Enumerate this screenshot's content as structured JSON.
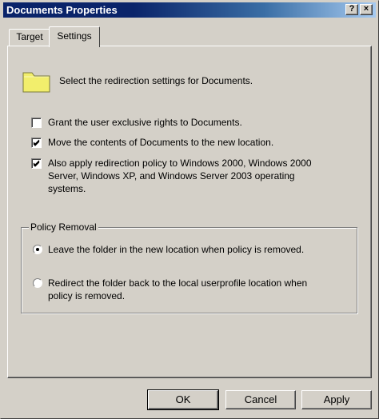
{
  "window": {
    "title": "Documents Properties",
    "help_label": "?",
    "close_label": "×"
  },
  "tabs": [
    {
      "label": "Target",
      "active": false
    },
    {
      "label": "Settings",
      "active": true
    }
  ],
  "settings": {
    "description": "Select the redirection settings for Documents.",
    "folder_icon": "folder-icon",
    "options": [
      {
        "label": "Grant the user exclusive rights to Documents.",
        "checked": false
      },
      {
        "label": "Move the contents of Documents to the new location.",
        "checked": true
      },
      {
        "label_lines": [
          "Also apply redirection policy to Windows 2000, Windows 2000",
          "Server, Windows XP, and Windows Server 2003 operating",
          "systems."
        ],
        "checked": true
      }
    ]
  },
  "policy_removal": {
    "label": "Policy Removal",
    "options": [
      {
        "label": "Leave the folder in the new location when policy is removed.",
        "selected": true
      },
      {
        "label_lines": [
          "Redirect the folder back to the local userprofile location when",
          "policy is removed."
        ],
        "selected": false
      }
    ]
  },
  "buttons": {
    "ok": "OK",
    "cancel": "Cancel",
    "apply": "Apply"
  },
  "colors": {
    "titlebar_start": "#0a246a",
    "titlebar_end": "#a6caf0",
    "folder": "#f2ee6c",
    "face": "#d4d0c8"
  }
}
